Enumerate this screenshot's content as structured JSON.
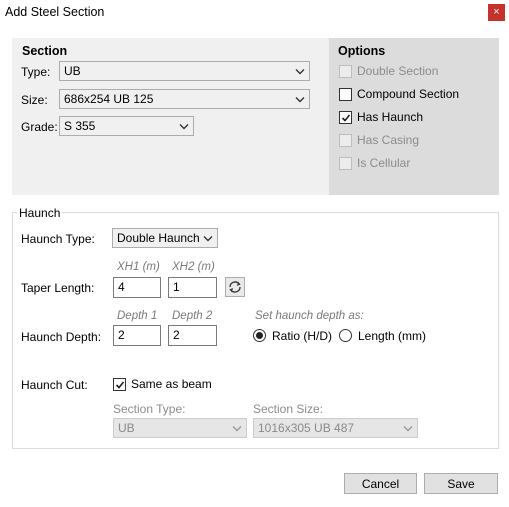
{
  "window": {
    "title": "Add Steel Section",
    "close_glyph": "×"
  },
  "section": {
    "heading": "Section",
    "type_label": "Type:",
    "type_value": "UB",
    "size_label": "Size:",
    "size_value": "686x254 UB 125",
    "grade_label": "Grade:",
    "grade_value": "S 355"
  },
  "options": {
    "heading": "Options",
    "items": [
      {
        "label": "Double Section",
        "checked": false,
        "enabled": false
      },
      {
        "label": "Compound Section",
        "checked": false,
        "enabled": true
      },
      {
        "label": "Has Haunch",
        "checked": true,
        "enabled": true
      },
      {
        "label": "Has Casing",
        "checked": false,
        "enabled": false
      },
      {
        "label": "Is Cellular",
        "checked": false,
        "enabled": false
      }
    ]
  },
  "haunch": {
    "group_title": "Haunch",
    "type_label": "Haunch Type:",
    "type_value": "Double Haunch",
    "taper_label": "Taper Length:",
    "xh1_header": "XH1 (m)",
    "xh2_header": "XH2 (m)",
    "xh1_value": "4",
    "xh2_value": "1",
    "swap_icon": "swap-ab-icon",
    "depth_label": "Haunch Depth:",
    "depth1_header": "Depth 1",
    "depth2_header": "Depth 2",
    "depth1_value": "2",
    "depth2_value": "2",
    "depth_mode_hint": "Set haunch depth as:",
    "ratio_label": "Ratio (H/D)",
    "length_label": "Length (mm)",
    "ratio_selected": true,
    "cut_label": "Haunch Cut:",
    "same_as_beam_label": "Same as beam",
    "same_as_beam_checked": true,
    "cut_type_header": "Section Type:",
    "cut_type_value": "UB",
    "cut_size_header": "Section Size:",
    "cut_size_value": "1016x305 UB 487"
  },
  "footer": {
    "cancel_label": "Cancel",
    "save_label": "Save"
  }
}
